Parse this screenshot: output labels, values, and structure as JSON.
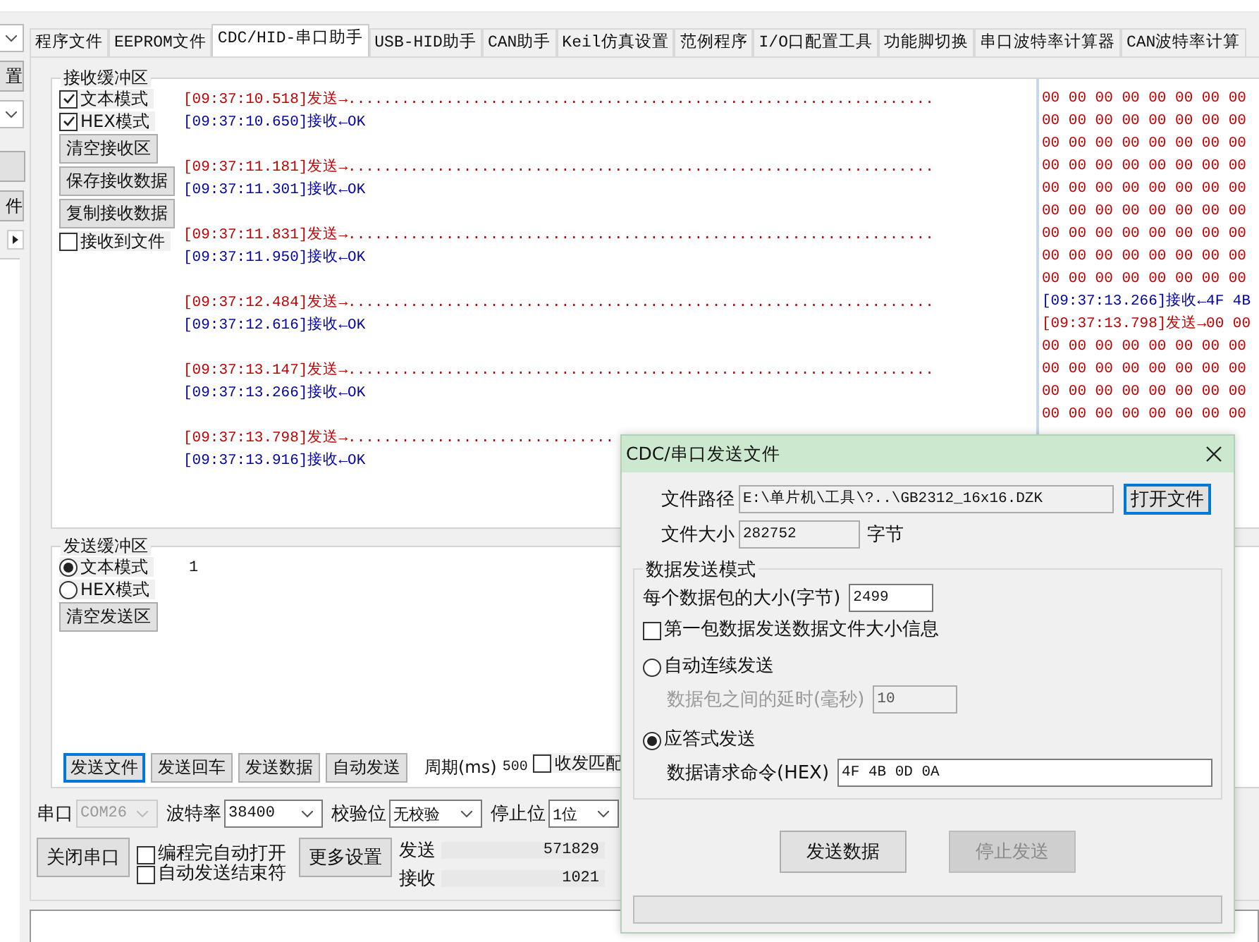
{
  "side_strip": {
    "items": [
      {
        "kind": "dropdown"
      },
      {
        "kind": "button",
        "label": "置"
      },
      {
        "kind": "dropdown"
      },
      {
        "kind": "blank"
      },
      {
        "kind": "button",
        "label": "件"
      },
      {
        "kind": "arrow"
      }
    ]
  },
  "tabs": [
    {
      "label": "程序文件",
      "selected": false
    },
    {
      "label": "EEPROM文件",
      "selected": false
    },
    {
      "label": "CDC/HID-串口助手",
      "selected": true
    },
    {
      "label": "USB-HID助手",
      "selected": false
    },
    {
      "label": "CAN助手",
      "selected": false
    },
    {
      "label": "Keil仿真设置",
      "selected": false
    },
    {
      "label": "范例程序",
      "selected": false
    },
    {
      "label": "I/O口配置工具",
      "selected": false
    },
    {
      "label": "功能脚切换",
      "selected": false
    },
    {
      "label": "串口波特率计算器",
      "selected": false
    },
    {
      "label": "CAN波特率计算",
      "selected": false
    }
  ],
  "receive": {
    "title": "接收缓冲区",
    "options": [
      {
        "label": "文本模式",
        "checked": true
      },
      {
        "label": "HEX模式",
        "checked": true
      }
    ],
    "buttons": [
      "清空接收区",
      "保存接收数据",
      "复制接收数据"
    ],
    "to_file": {
      "label": "接收到文件",
      "checked": false
    },
    "log": [
      {
        "kind": "send",
        "text": "[09:37:10.518]发送→.................................................................."
      },
      {
        "kind": "recv",
        "text": "[09:37:10.650]接收←OK"
      },
      {
        "kind": "send",
        "text": "[09:37:11.181]发送→.................................................................."
      },
      {
        "kind": "recv",
        "text": "[09:37:11.301]接收←OK"
      },
      {
        "kind": "send",
        "text": "[09:37:11.831]发送→.................................................................."
      },
      {
        "kind": "recv",
        "text": "[09:37:11.950]接收←OK"
      },
      {
        "kind": "send",
        "text": "[09:37:12.484]发送→.................................................................."
      },
      {
        "kind": "recv",
        "text": "[09:37:12.616]接收←OK"
      },
      {
        "kind": "send",
        "text": "[09:37:13.147]发送→.................................................................."
      },
      {
        "kind": "recv",
        "text": "[09:37:13.266]接收←OK"
      },
      {
        "kind": "send",
        "text": "[09:37:13.798]发送→.............................."
      },
      {
        "kind": "recv",
        "text": "[09:37:13.916]接收←OK"
      }
    ],
    "hex_log": [
      {
        "kind": "send",
        "text": "00 00 00 00 00 00 00 00"
      },
      {
        "kind": "send",
        "text": "00 00 00 00 00 00 00 00"
      },
      {
        "kind": "send",
        "text": "00 00 00 00 00 00 00 00"
      },
      {
        "kind": "send",
        "text": "00 00 00 00 00 00 00 00"
      },
      {
        "kind": "send",
        "text": "00 00 00 00 00 00 00 00"
      },
      {
        "kind": "send",
        "text": "00 00 00 00 00 00 00 00"
      },
      {
        "kind": "send",
        "text": "00 00 00 00 00 00 00 00"
      },
      {
        "kind": "send",
        "text": "00 00 00 00 00 00 00 00"
      },
      {
        "kind": "send",
        "text": "00 00 00 00 00 00 00 00"
      },
      {
        "kind": "recv",
        "text": "[09:37:13.266]接收←4F 4B"
      },
      {
        "kind": "send",
        "text": "[09:37:13.798]发送→00 00"
      },
      {
        "kind": "send",
        "text": "00 00 00 00 00 00 00 00"
      },
      {
        "kind": "send",
        "text": "00 00 00 00 00 00 00 00"
      },
      {
        "kind": "send",
        "text": "00 00 00 00 00 00 00 00"
      },
      {
        "kind": "send",
        "text": "00 00 00 00 00 00 00 00"
      }
    ]
  },
  "send": {
    "title": "发送缓冲区",
    "modes": [
      {
        "label": "文本模式",
        "selected": true
      },
      {
        "label": "HEX模式",
        "selected": false
      }
    ],
    "clear_button": "清空发送区",
    "content": "1",
    "buttons": [
      {
        "label": "发送文件",
        "focused": true
      },
      {
        "label": "发送回车",
        "focused": false
      },
      {
        "label": "发送数据",
        "focused": false
      },
      {
        "label": "自动发送",
        "focused": false
      }
    ],
    "period_label": "周期(ms)",
    "period_value": "500",
    "match": {
      "label": "收发匹配",
      "checked": false
    }
  },
  "port_settings": [
    {
      "label": "串口",
      "value": "COM26",
      "disabled": true
    },
    {
      "label": "波特率",
      "value": "38400",
      "disabled": false
    },
    {
      "label": "校验位",
      "value": "无校验",
      "disabled": false
    },
    {
      "label": "停止位",
      "value": "1位",
      "disabled": false
    }
  ],
  "actions": {
    "close_port": "关闭串口",
    "checkboxes": [
      {
        "label": "编程完自动打开",
        "checked": false
      },
      {
        "label": "自动发送结束符",
        "checked": false
      }
    ],
    "more_settings": "更多设置",
    "counters": [
      {
        "label": "发送",
        "value": "571829"
      },
      {
        "label": "接收",
        "value": "1021"
      }
    ]
  },
  "dialog": {
    "title": "CDC/串口发送文件",
    "path_label": "文件路径",
    "path_value": "E:\\单片机\\工具\\?..\\GB2312_16x16.DZK",
    "open_button": "打开文件",
    "size_label": "文件大小",
    "size_value": "282752",
    "size_unit": "字节",
    "group_title": "数据发送模式",
    "packet_label": "每个数据包的大小(字节)",
    "packet_value": "2499",
    "first_packet": {
      "label": "第一包数据发送数据文件大小信息",
      "checked": false
    },
    "modes": [
      {
        "label": "自动连续发送",
        "selected": false,
        "sub_label": "数据包之间的延时(毫秒)",
        "sub_value": "10"
      },
      {
        "label": "应答式发送",
        "selected": true,
        "sub_label": "数据请求命令(HEX)",
        "sub_value": "4F 4B 0D 0A"
      }
    ],
    "buttons": [
      {
        "label": "发送数据",
        "disabled": false
      },
      {
        "label": "停止发送",
        "disabled": true
      }
    ],
    "progress": {
      "level": 0
    }
  }
}
